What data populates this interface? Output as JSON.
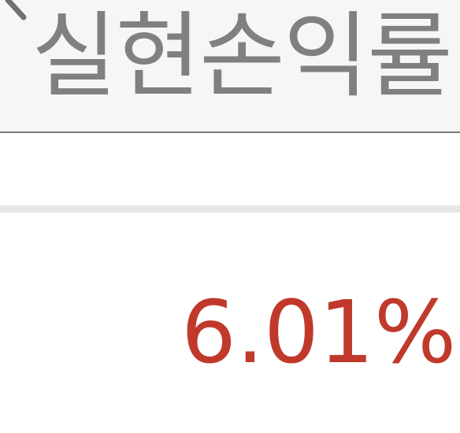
{
  "header": {
    "title": "실현손익률",
    "back_icon": "chevron-left-icon"
  },
  "realized_rate": {
    "value": "6.01%",
    "color": "#c0392b"
  },
  "colors": {
    "header_bg": "#f6f6f6",
    "title_text": "#808080",
    "divider": "#e6e6e6"
  }
}
